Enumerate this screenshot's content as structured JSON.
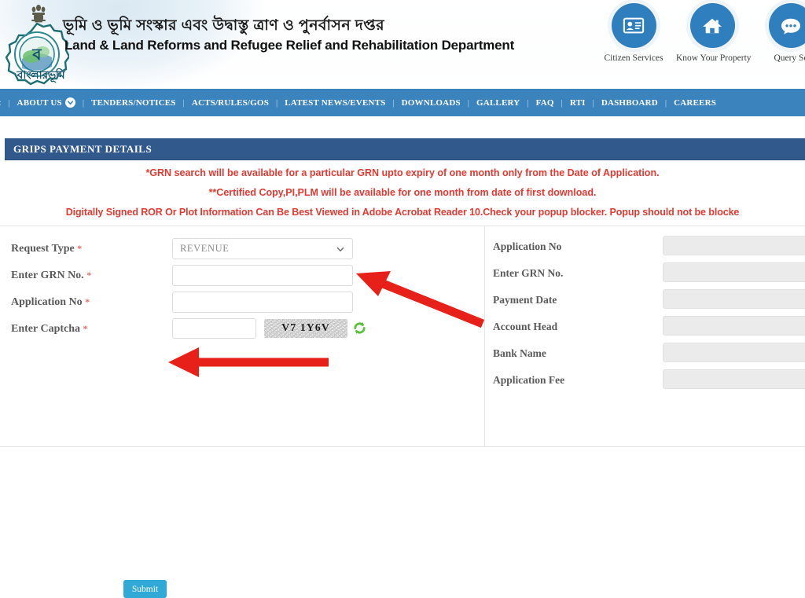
{
  "header": {
    "logo": {
      "emblem_icon": "india-state-emblem-icon",
      "gear_icon": "banglarbhumi-gear-emblem-icon",
      "bangla_wordmark": "বাংলারভূমি"
    },
    "title_bn": "ভূমি ও ভূমি সংস্কার এবং উদ্বাস্তু ত্রাণ ও পুনর্বাসন দপ্তর",
    "title_en": "Land & Land Reforms and Refugee Relief and Rehabilitation Department",
    "quicklinks": [
      {
        "label": "Citizen Services",
        "icon": "id-card-icon"
      },
      {
        "label": "Know Your Property",
        "icon": "home-icon"
      },
      {
        "label": "Query Se",
        "icon": "chat-bubble-icon"
      }
    ]
  },
  "nav": {
    "leading_arrow": "‹",
    "items": [
      {
        "label": "ABOUT US",
        "has_caret": true
      },
      {
        "label": "TENDERS/NOTICES",
        "has_caret": false
      },
      {
        "label": "ACTS/RULES/GOS",
        "has_caret": false
      },
      {
        "label": "LATEST NEWS/EVENTS",
        "has_caret": false
      },
      {
        "label": "DOWNLOADS",
        "has_caret": false
      },
      {
        "label": "GALLERY",
        "has_caret": false
      },
      {
        "label": "FAQ",
        "has_caret": false
      },
      {
        "label": "RTI",
        "has_caret": false
      },
      {
        "label": "DASHBOARD",
        "has_caret": false
      },
      {
        "label": "CAREERS",
        "has_caret": false
      }
    ],
    "separator": "|"
  },
  "panel": {
    "title": "GRIPS PAYMENT DETAILS"
  },
  "notices": [
    "*GRN search will be available for a particular GRN upto expiry of one month only from the Date of Application.",
    "**Certified Copy,PI,PLM will be available for one month from date of first download.",
    "Digitally Signed ROR Or Plot Information Can Be Best Viewed in Adobe Acrobat Reader 10.Check your popup blocker. Popup should not be blocke"
  ],
  "form": {
    "request_type": {
      "label": "Request Type",
      "required": "*",
      "value": "REVENUE",
      "options": [
        "REVENUE"
      ]
    },
    "grn_no": {
      "label": "Enter GRN No.",
      "required": "*",
      "value": "",
      "placeholder": ""
    },
    "application_no": {
      "label": "Application No",
      "required": "*",
      "value": "",
      "placeholder": ""
    },
    "captcha": {
      "label": "Enter Captcha",
      "required": "*",
      "value": "",
      "placeholder": "",
      "image_text": "V7 1Y6V",
      "refresh_icon": "refresh-icon"
    },
    "submit_label": "Submit"
  },
  "details": {
    "rows": [
      {
        "label": "Application No",
        "value": ""
      },
      {
        "label": "Enter GRN No.",
        "value": ""
      },
      {
        "label": "Payment Date",
        "value": ""
      },
      {
        "label": "Account Head",
        "value": ""
      },
      {
        "label": "Bank Name",
        "value": ""
      },
      {
        "label": "Application Fee",
        "value": ""
      }
    ]
  },
  "annotations": {
    "arrow_color": "#e8201a",
    "arrow_1": "points to Enter GRN No. input",
    "arrow_2": "points to Submit button"
  },
  "colors": {
    "nav_blue": "#3b83bd",
    "panel_blue": "#31598c",
    "notice_red": "#e23a32",
    "submit_blue": "#31a9d6",
    "quicklink_blue": "#2f7fbf",
    "label_gray": "#5a5a5a",
    "disabled_field": "#ebebeb"
  }
}
